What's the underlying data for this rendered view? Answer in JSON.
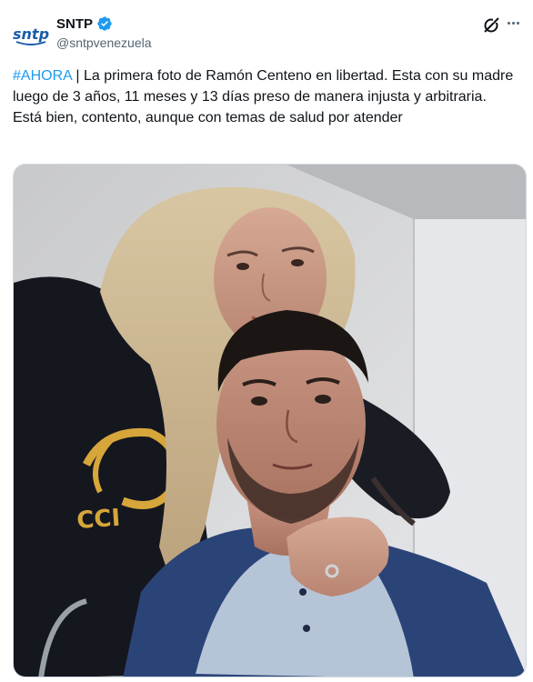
{
  "account": {
    "display_name": "SNTP",
    "handle": "@sntpvenezuela",
    "logo_text": "sntp",
    "verified": true
  },
  "post": {
    "hashtag": "#AHORA",
    "text_line1": " | La primera foto de Ramón Centeno en libertad. Esta con su madre luego de 3 años, 11 meses y 13 días preso de manera injusta y arbitraria.",
    "text_line2": "Está bien, contento, aunque con temas de salud por atender"
  },
  "photo": {
    "subject": "photo",
    "shirt_text": "CCI"
  },
  "colors": {
    "accent": "#1d9bf0",
    "text": "#0f1419",
    "secondary": "#536471"
  },
  "icons": {
    "verified": "verified-badge-icon",
    "grok": "grok-icon",
    "more": "more-icon"
  }
}
